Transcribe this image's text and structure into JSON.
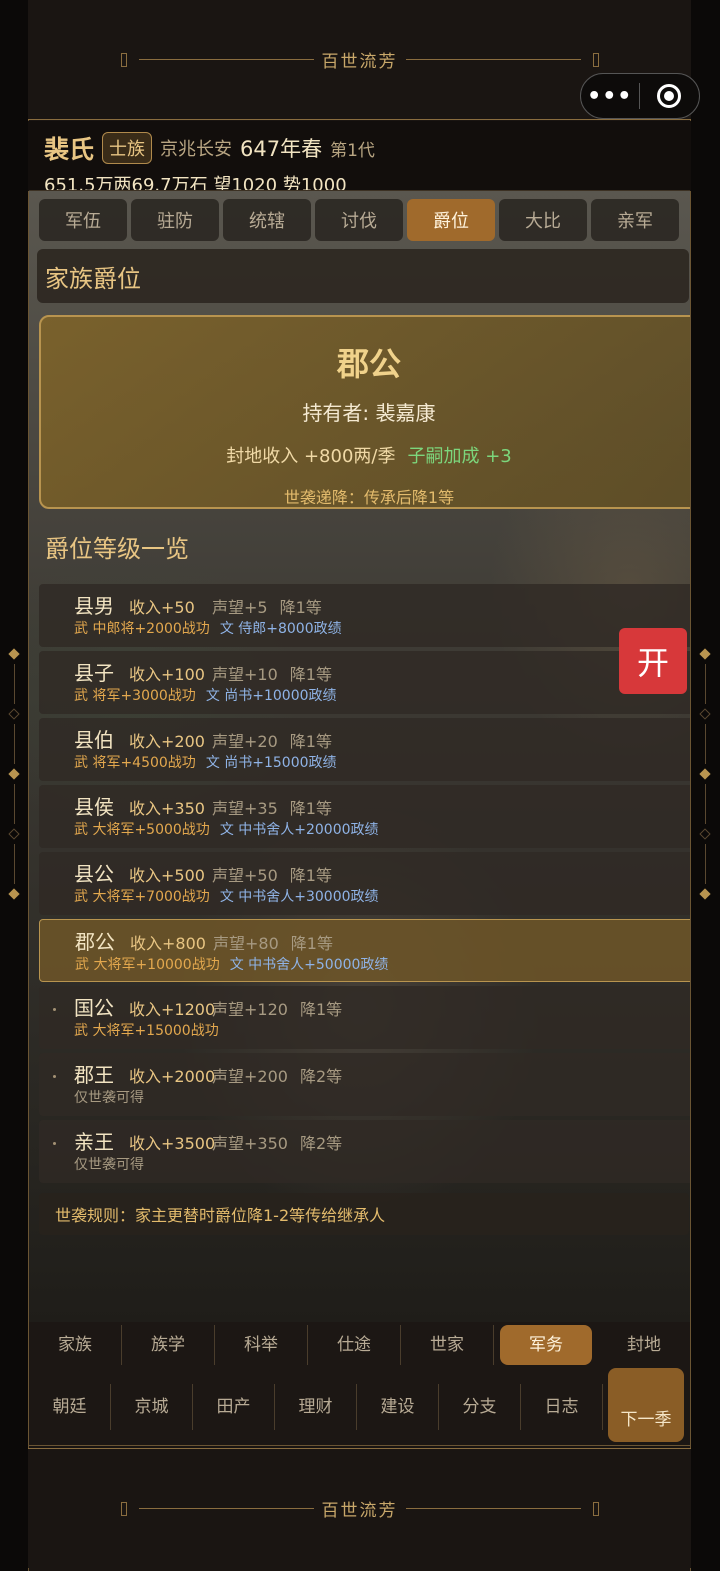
{
  "app": {
    "banner_title": "百世流芳"
  },
  "header": {
    "family": "裴氏",
    "class_badge": "士族",
    "location": "京兆长安",
    "year": "647年春",
    "generation": "第1代",
    "stats": "651.5万两69.7万石  望1020  势1000"
  },
  "tabs": [
    "军伍",
    "驻防",
    "统辖",
    "讨伐",
    "爵位",
    "大比",
    "亲军"
  ],
  "active_tab": "爵位",
  "section_family_rank": "家族爵位",
  "current_rank": {
    "rank": "郡公",
    "holder": "持有者: 裴嘉康",
    "income": "封地收入 +800两/季",
    "bonus": "子嗣加成 +3",
    "inherit_rule": "世袭递降：传承后降1等"
  },
  "section_rank_list": "爵位等级一览",
  "ranks": [
    {
      "name": "县男",
      "income": "收入+50",
      "prestige": "声望+5",
      "drop": "降1等",
      "wu": "武 中郎将+2000战功",
      "wen": "文 侍郎+8000政绩",
      "current": false,
      "dot": false
    },
    {
      "name": "县子",
      "income": "收入+100",
      "prestige": "声望+10",
      "drop": "降1等",
      "wu": "武 将军+3000战功",
      "wen": "文 尚书+10000政绩",
      "current": false,
      "dot": false
    },
    {
      "name": "县伯",
      "income": "收入+200",
      "prestige": "声望+20",
      "drop": "降1等",
      "wu": "武 将军+4500战功",
      "wen": "文 尚书+15000政绩",
      "current": false,
      "dot": false
    },
    {
      "name": "县侯",
      "income": "收入+350",
      "prestige": "声望+35",
      "drop": "降1等",
      "wu": "武 大将军+5000战功",
      "wen": "文 中书舍人+20000政绩",
      "current": false,
      "dot": false
    },
    {
      "name": "县公",
      "income": "收入+500",
      "prestige": "声望+50",
      "drop": "降1等",
      "wu": "武 大将军+7000战功",
      "wen": "文 中书舍人+30000政绩",
      "current": false,
      "dot": false
    },
    {
      "name": "郡公",
      "income": "收入+800",
      "prestige": "声望+80",
      "drop": "降1等",
      "wu": "武 大将军+10000战功",
      "wen": "文 中书舍人+50000政绩",
      "current": true,
      "dot": false
    },
    {
      "name": "国公",
      "income": "收入+1200",
      "prestige": "声望+120",
      "drop": "降1等",
      "wu": "武 大将军+15000战功",
      "wen": "",
      "current": false,
      "dot": true
    },
    {
      "name": "郡王",
      "income": "收入+2000",
      "prestige": "声望+200",
      "drop": "降2等",
      "note": "仅世袭可得",
      "current": false,
      "dot": true
    },
    {
      "name": "亲王",
      "income": "收入+3500",
      "prestige": "声望+350",
      "drop": "降2等",
      "note": "仅世袭可得",
      "current": false,
      "dot": true
    }
  ],
  "footnote": "世袭规则：家主更替时爵位降1-2等传给继承人",
  "open_button": "开",
  "nav_row1": [
    "家族",
    "族学",
    "科举",
    "仕途",
    "世家",
    "军务",
    "封地"
  ],
  "nav_row1_active": "军务",
  "nav_row2": [
    "朝廷",
    "京城",
    "田产",
    "理财",
    "建设",
    "分支",
    "日志"
  ],
  "next_season": "下一季"
}
